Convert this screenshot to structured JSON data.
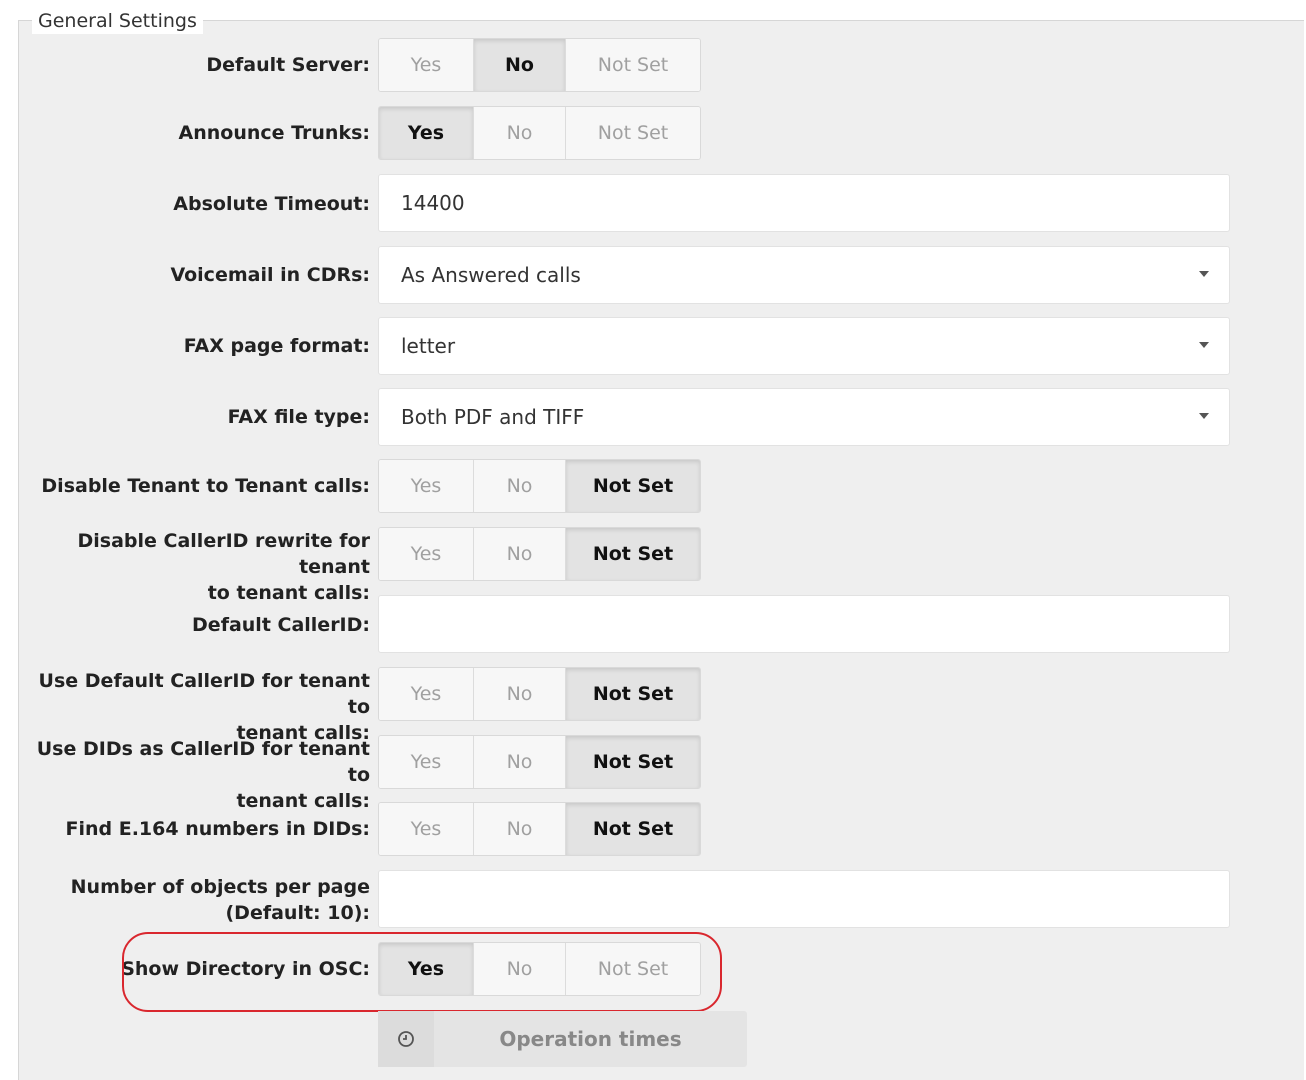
{
  "fieldset": {
    "legend": "General Settings"
  },
  "toggle_options": {
    "yes": "Yes",
    "no": "No",
    "not_set": "Not Set"
  },
  "fields": {
    "default_server": {
      "label": "Default Server:",
      "value": "No"
    },
    "announce_trunks": {
      "label": "Announce Trunks:",
      "value": "Yes"
    },
    "absolute_timeout": {
      "label": "Absolute Timeout:",
      "value": "14400"
    },
    "voicemail_cdrs": {
      "label": "Voicemail in CDRs:",
      "value": "As Answered calls"
    },
    "fax_page_format": {
      "label": "FAX page format:",
      "value": "letter"
    },
    "fax_file_type": {
      "label": "FAX file type:",
      "value": "Both PDF and TIFF"
    },
    "disable_tenant_calls": {
      "label": "Disable Tenant to Tenant calls:",
      "value": "Not Set"
    },
    "disable_callerid_rewrite": {
      "label_line1": "Disable CallerID rewrite for tenant",
      "label_line2": "to tenant calls:",
      "value": "Not Set"
    },
    "default_callerid": {
      "label": "Default CallerID:",
      "value": ""
    },
    "use_default_callerid": {
      "label_line1": "Use Default CallerID for tenant to",
      "label_line2": "tenant calls:",
      "value": "Not Set"
    },
    "use_dids_callerid": {
      "label_line1": "Use DIDs as CallerID for tenant to",
      "label_line2": "tenant calls:",
      "value": "Not Set"
    },
    "find_e164": {
      "label": "Find E.164 numbers in DIDs:",
      "value": "Not Set"
    },
    "objects_per_page": {
      "label_line1": "Number of objects per page",
      "label_line2": "(Default: 10):",
      "value": ""
    },
    "show_directory_osc": {
      "label": "Show Directory in OSC:",
      "value": "Yes"
    }
  },
  "operation_times": {
    "label": "Operation times",
    "icon": "clock-icon"
  },
  "colors": {
    "highlight": "#d9272e",
    "background": "#efefef"
  }
}
